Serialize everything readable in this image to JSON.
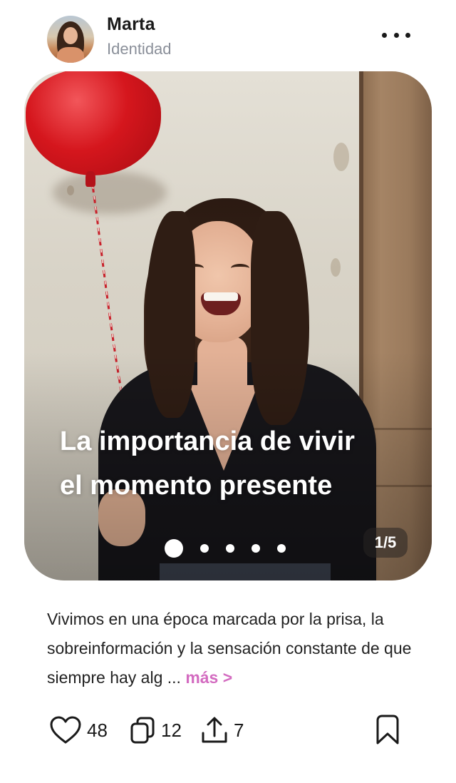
{
  "author": {
    "name": "Marta",
    "subtitle": "Identidad"
  },
  "post": {
    "title": "La importancia de vivir\nel momento presente",
    "slide_counter": "1/5",
    "slides_total": 5,
    "active_slide": 1,
    "description": "Vivimos en una época marcada por la prisa, la sobreinformación y la sensación constante de que siempre hay alg ...",
    "more_label": "más >",
    "accent_color": "#d36bc0"
  },
  "actions": {
    "likes": "48",
    "reposts": "12",
    "shares": "7",
    "icons": [
      "heart-icon",
      "repost-icon",
      "share-icon",
      "bookmark-icon"
    ]
  },
  "menu": {
    "icon": "more-horizontal-icon"
  }
}
